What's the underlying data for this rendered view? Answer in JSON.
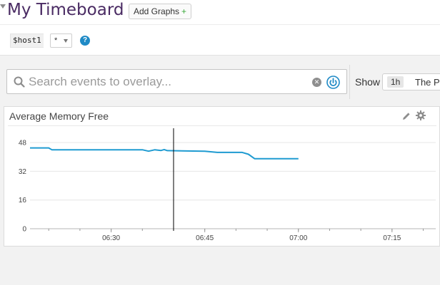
{
  "header": {
    "title": "My Timeboard",
    "add_graphs_label": "Add Graphs",
    "add_graphs_plus": "+"
  },
  "template_vars": [
    {
      "name": "$host1",
      "value": "*"
    }
  ],
  "help_icon_glyph": "?",
  "search": {
    "placeholder": "Search events to overlay..."
  },
  "show": {
    "label": "Show",
    "range": "1h",
    "text": "The P"
  },
  "icons": {
    "search": "search-icon",
    "clear": "clear-icon",
    "overlay": "power-overlay-icon",
    "edit": "pencil-icon",
    "settings": "gear-icon"
  },
  "colors": {
    "title": "#4a2b63",
    "series": "#1f9bd1",
    "help": "#1f8ac6",
    "add_plus": "#3aa83a"
  },
  "chart_data": {
    "type": "line",
    "title": "Average Memory Free",
    "xlabel": "",
    "ylabel": "",
    "ylim": [
      0,
      52
    ],
    "yticks": [
      0,
      16,
      32,
      48
    ],
    "xlim": [
      "06:17",
      "07:22"
    ],
    "xticks": [
      "06:30",
      "06:45",
      "07:00",
      "07:15"
    ],
    "grid": true,
    "marker_time": "06:40",
    "series": [
      {
        "x": [
          "06:17",
          "06:20",
          "06:20.5",
          "06:35",
          "06:36",
          "06:37",
          "06:38",
          "06:38.5",
          "06:39",
          "06:45",
          "06:47",
          "06:51",
          "06:52",
          "06:53",
          "07:00"
        ],
        "values": [
          45,
          45,
          44,
          44,
          43.2,
          44,
          43.6,
          44.1,
          43.5,
          43.2,
          42.5,
          42.5,
          41.5,
          39,
          39
        ]
      }
    ]
  }
}
